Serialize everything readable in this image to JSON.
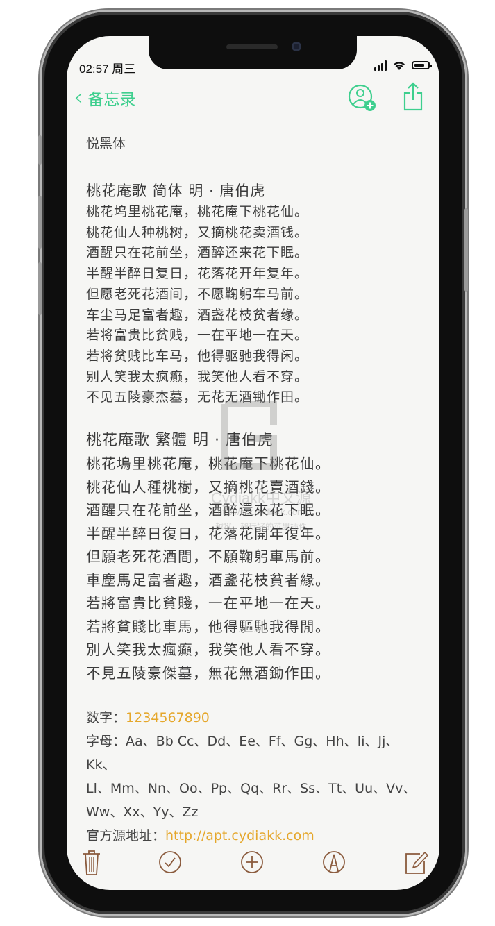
{
  "status_bar": {
    "time": "02:57 周三"
  },
  "nav": {
    "back_label": "备忘录"
  },
  "note": {
    "font_name": "悦黑体",
    "poems": [
      {
        "title": "桃花庵歌 简体 明 · 唐伯虎",
        "lines": [
          "桃花坞里桃花庵，桃花庵下桃花仙。",
          "桃花仙人种桃树，又摘桃花卖酒钱。",
          "酒醒只在花前坐，酒醉还来花下眠。",
          "半醒半醉日复日，花落花开年复年。",
          "但愿老死花酒间，不愿鞠躬车马前。",
          "车尘马足富者趣，酒盏花枝贫者缘。",
          "若将富贵比贫贱，一在平地一在天。",
          "若将贫贱比车马，他得驱驰我得闲。",
          "别人笑我太疯癫，我笑他人看不穿。",
          "不见五陵豪杰墓，无花无酒锄作田。"
        ]
      },
      {
        "title": "桃花庵歌 繁體 明 · 唐伯虎",
        "lines": [
          "桃花塢里桃花庵，桃花庵下桃花仙。",
          "桃花仙人種桃樹，又摘桃花賣酒錢。",
          "酒醒只在花前坐，酒醉還來花下眠。",
          "半醒半醉日復日，花落花開年復年。",
          "但願老死花酒間，不願鞠躬車馬前。",
          "車塵馬足富者趣，酒盞花枝貧者緣。",
          "若將富貴比貧賤，一在平地一在天。",
          "若將貧賤比車馬，他得驅馳我得閒。",
          "別人笑我太瘋癲，我笑他人看不穿。",
          "不見五陵豪傑墓，無花無酒鋤作田。"
        ]
      }
    ],
    "digits_label": "数字：",
    "digits_value": "1234567890",
    "letters_label": "字母：",
    "letters_line1": "Aa、Bb Cc、Dd、Ee、Ff、Gg、Hh、Ii、Jj、Kk、",
    "letters_line2": "Ll、Mm、Nn、Oo、Pp、Qq、Rr、Ss、Tt、Uu、Vv、",
    "letters_line3": "Ww、Xx、Yy、Zz",
    "source_label": "官方源地址：",
    "source_url": "http://apt.cydiakk.com"
  },
  "watermark": {
    "line1": "Cydiakk中文源",
    "line2": "http://apt.cydiakk.com",
    "line3": "越狱，趣玩好的苹果插件"
  },
  "colors": {
    "accent_green": "#3ecf8e",
    "link_orange": "#e5a72b",
    "toolbar_brown": "#8a5a3c"
  },
  "icons": {
    "back": "chevron-left-icon",
    "share_user": "person-add-icon",
    "share": "share-icon",
    "toolbar": [
      "trash-icon",
      "checklist-icon",
      "add-icon",
      "markup-pen-icon",
      "compose-icon"
    ]
  }
}
